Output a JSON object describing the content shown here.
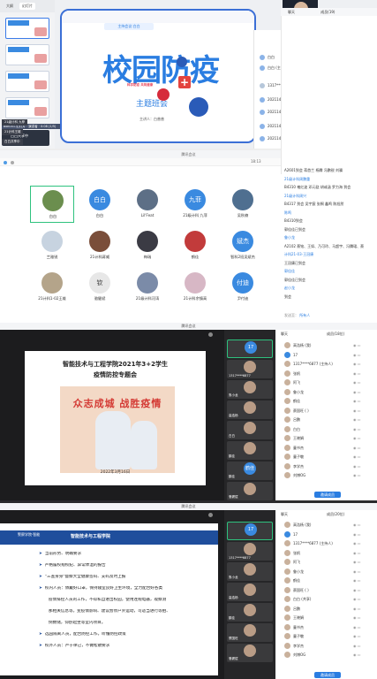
{
  "panel1": {
    "tabs": [
      "大纲",
      "幻灯片"
    ],
    "thumb_status": "bok001-幻灯片 · 演讲者 · 0:08 (1/5)",
    "mini_label": "白白共享中",
    "slide": {
      "title": "校园防疫",
      "subtitle": "科学防疫 共筑健康",
      "heading": "主题班会",
      "author": "主讲人：白普普"
    },
    "video_label": "白白",
    "chat_header": "成员(18)",
    "chat_rows": [
      "白白",
      "白白 (主持人)",
      "1317****6485",
      "20211440352计科陈鹏",
      "20211443182-智科1-孙永博",
      "20211442297智科幻楼",
      "20211443048智能曹宇恩"
    ]
  },
  "panel2": {
    "window_title": "腾讯会议",
    "time": "18:13",
    "host_badge": "主持会议:白白",
    "participants": [
      {
        "name": "白白",
        "short": ""
      },
      {
        "name": "白白",
        "short": "白白"
      },
      {
        "name": "Lil'Feat",
        "short": ""
      },
      {
        "name": "21级计科 九菲",
        "short": "九菲"
      },
      {
        "name": "吴秋楠",
        "short": ""
      },
      {
        "name": "兰雅锐",
        "short": ""
      },
      {
        "name": "21计科蔣威",
        "short": ""
      },
      {
        "name": "梅瑞",
        "short": ""
      },
      {
        "name": "鹤佳",
        "short": ""
      },
      {
        "name": "智科2班吴斌杰",
        "short": "斌杰"
      },
      {
        "name": "21计科1-02王雄",
        "short": ""
      },
      {
        "name": "骆健斌",
        "short": "钦"
      },
      {
        "name": "21级计科河涛",
        "short": ""
      },
      {
        "name": "21计科余镇高",
        "short": ""
      },
      {
        "name": "尹付迪",
        "short": "付迪"
      }
    ],
    "overlay_labels": [
      "21级计科 九菲",
      "21计科王雄",
      "白白共享中"
    ],
    "chat_tabs": [
      "聊天",
      "成员(19)"
    ],
    "chat_lines": [
      {
        "text": "A2601到会 蒋首兰 杨腾 冯鹏锐 刘骥",
        "blue": false
      },
      {
        "text": "21级计科周鹏重",
        "blue": true
      },
      {
        "text": "B4310 褚红波 邓元骁 胡彧涵 罗力海 到会",
        "blue": false
      },
      {
        "text": "21级计科周兴",
        "blue": true
      },
      {
        "text": "B4317 到会 吴宇宸 张桐 鑫鸣 陈旭然",
        "blue": false
      },
      {
        "text": "陈鸣",
        "blue": true
      },
      {
        "text": "B4310到会",
        "blue": false
      },
      {
        "text": "郭佳佳已到会",
        "blue": false
      },
      {
        "text": "鲁小龙",
        "blue": true
      },
      {
        "text": "A2102 蔡铭、王如、乃可玲、马超宇、冯腾珺、蔡",
        "blue": false
      },
      {
        "text": "计科21-03-王冠康",
        "blue": true
      },
      {
        "text": "王冠康已到会",
        "blue": false
      },
      {
        "text": "郭佳佳",
        "blue": true
      },
      {
        "text": "郭佳佳已到会",
        "blue": false
      },
      {
        "text": "赵小龙",
        "blue": true
      },
      {
        "text": "到会",
        "blue": false
      }
    ],
    "send_to_label": "发送至：",
    "send_to_value": "所有人"
  },
  "panel3": {
    "window_title": "腾讯会议",
    "slide_title_1": "智能技术与工程学院2021年3+2学生",
    "slide_title_2": "疫情防控专题会",
    "slogan": "众志成城 战胜疫情",
    "date": "2022年3月16日",
    "video_tiles": [
      {
        "name": "17",
        "label": ""
      },
      {
        "name": "",
        "label": "1317****6877"
      },
      {
        "name": "",
        "label": "鲁小龙"
      },
      {
        "name": "",
        "label": "高浩杨"
      },
      {
        "name": "",
        "label": "白白"
      },
      {
        "name": "",
        "label": "鹤佳"
      },
      {
        "name": "鹤佳",
        "label": "鹤佳"
      },
      {
        "name": "",
        "label": "骆健斌"
      }
    ],
    "chat_tab": "聊天",
    "members_tab": "成员(18位)",
    "members": [
      "高浩杨 (我)",
      "17",
      "1317****6877 (主持人)",
      "张帆",
      "阿飞",
      "鲁小龙",
      "鹤佳",
      "蔡国旺 ( )",
      "吕鹏",
      "白白",
      "王晓娟",
      "童书杰",
      "童子敬",
      "李学杰",
      "刘博OG"
    ],
    "invite_label": "邀请成员",
    "bottom_status": "会议详情"
  },
  "panel4": {
    "window_title": "腾讯会议",
    "school_logo": "警察学院·智能",
    "slide_header": "智能技术与工程学院",
    "bullets": [
      "当前形势、明确要求",
      "严格履校规校纪、异常体温的报告",
      "\"三查身身\"督察大全健康签码、支码及时上报",
      "校内人员：佩戴好口罩，保持寝室良好卫生环境，全力配合好各类",
      "疫情排控人员的工作，不得私自进出校园，使用连规电器，观察测",
      "那相关信息等，变疫情影响、建议暂停户外运动，可适当进行等拍、",
      "倒数储，仰卧起坐等室内项目。",
      "选园隔离人员，配合防控工作，听懂防控政策",
      "校外人员：严于律己，不做松散要求"
    ],
    "video_tiles": [
      {
        "name": "17",
        "label": ""
      },
      {
        "name": "",
        "label": "1317****6877"
      },
      {
        "name": "",
        "label": "鲁小龙"
      },
      {
        "name": "",
        "label": "高浩杨"
      },
      {
        "name": "",
        "label": "鹤佳"
      },
      {
        "name": "",
        "label": "蔡国旺"
      },
      {
        "name": "",
        "label": "骆健斌"
      }
    ],
    "chat_tab": "聊天",
    "members_tab": "成员(20位)",
    "members": [
      "高浩杨 (我)",
      "17",
      "1317****6877 (主持人)",
      "张帆",
      "阿飞",
      "鲁小龙",
      "鹤佳",
      "蔡国旺 ( )",
      "白白 (共享)",
      "吕鹏",
      "王晓娟",
      "童书杰",
      "童子敬",
      "李学杰",
      "刘博OG"
    ],
    "invite_label": "邀请成员"
  },
  "colors": {
    "accent": "#2a7de1",
    "slide_border": "#3b6fd6",
    "header_blue": "#1f4e9c",
    "slogan_red": "#d43b35"
  }
}
